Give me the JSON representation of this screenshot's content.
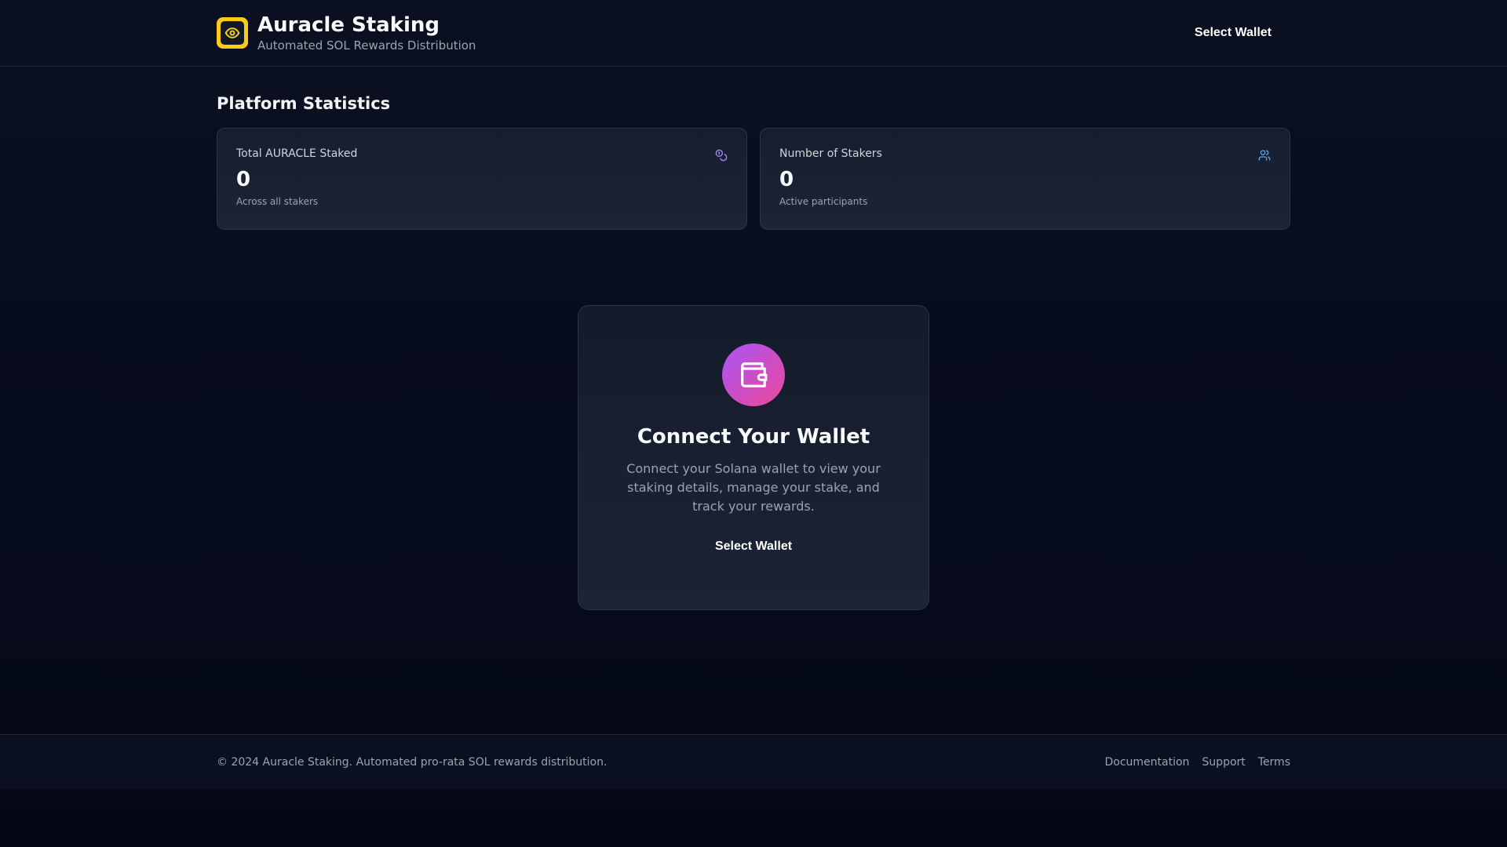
{
  "header": {
    "title": "Auracle Staking",
    "subtitle": "Automated SOL Rewards Distribution",
    "wallet_button": "Select Wallet",
    "logo_icon": "eye-icon"
  },
  "stats": {
    "section_title": "Platform Statistics",
    "cards": [
      {
        "label": "Total AURACLE Staked",
        "value": "0",
        "sub": "Across all stakers",
        "icon": "coins-icon",
        "icon_color": "#a78bfa"
      },
      {
        "label": "Number of Stakers",
        "value": "0",
        "sub": "Active participants",
        "icon": "users-icon",
        "icon_color": "#60a5fa"
      }
    ]
  },
  "connect": {
    "icon": "wallet-icon",
    "title": "Connect Your Wallet",
    "description": "Connect your Solana wallet to view your staking details, manage your stake, and track your rewards.",
    "button": "Select Wallet"
  },
  "footer": {
    "copyright": "© 2024 Auracle Staking. Automated pro-rata SOL rewards distribution.",
    "links": [
      "Documentation",
      "Support",
      "Terms"
    ]
  },
  "colors": {
    "accent_gradient_start": "#a855f7",
    "accent_gradient_end": "#ec4899",
    "logo_yellow": "#facc15"
  }
}
